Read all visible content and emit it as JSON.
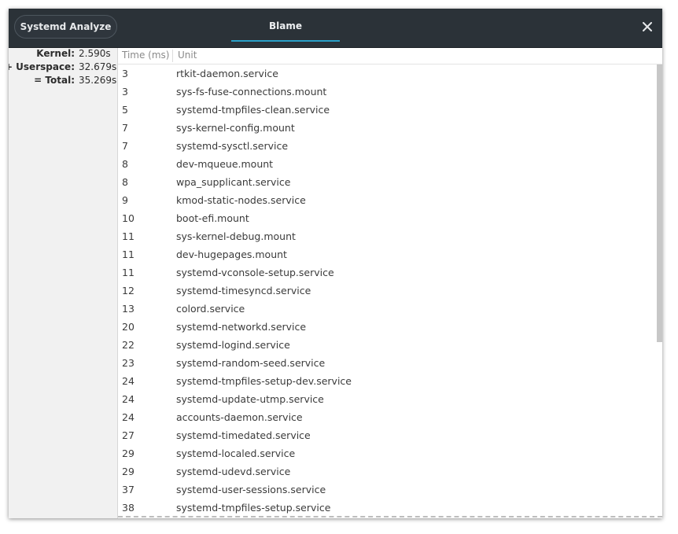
{
  "titlebar": {
    "app_button_label": "Systemd Analyze",
    "tab_label": "Blame",
    "close_icon": "close-icon",
    "accent_color": "#2aa0c8"
  },
  "summary": {
    "kernel_label": "Kernel:",
    "kernel_value": "2.590s",
    "userspace_label": "+ Userspace:",
    "userspace_value": "32.679s",
    "total_label": "= Total:",
    "total_value": "35.269s"
  },
  "table": {
    "columns": [
      "Time (ms)",
      "Unit"
    ],
    "rows": [
      [
        "3",
        "rtkit-daemon.service"
      ],
      [
        "3",
        "sys-fs-fuse-connections.mount"
      ],
      [
        "5",
        "systemd-tmpfiles-clean.service"
      ],
      [
        "7",
        "sys-kernel-config.mount"
      ],
      [
        "7",
        "systemd-sysctl.service"
      ],
      [
        "8",
        "dev-mqueue.mount"
      ],
      [
        "8",
        "wpa_supplicant.service"
      ],
      [
        "9",
        "kmod-static-nodes.service"
      ],
      [
        "10",
        "boot-efi.mount"
      ],
      [
        "11",
        "sys-kernel-debug.mount"
      ],
      [
        "11",
        "dev-hugepages.mount"
      ],
      [
        "11",
        "systemd-vconsole-setup.service"
      ],
      [
        "12",
        "systemd-timesyncd.service"
      ],
      [
        "13",
        "colord.service"
      ],
      [
        "20",
        "systemd-networkd.service"
      ],
      [
        "22",
        "systemd-logind.service"
      ],
      [
        "23",
        "systemd-random-seed.service"
      ],
      [
        "24",
        "systemd-tmpfiles-setup-dev.service"
      ],
      [
        "24",
        "systemd-update-utmp.service"
      ],
      [
        "24",
        "accounts-daemon.service"
      ],
      [
        "27",
        "systemd-timedated.service"
      ],
      [
        "29",
        "systemd-localed.service"
      ],
      [
        "29",
        "systemd-udevd.service"
      ],
      [
        "37",
        "systemd-user-sessions.service"
      ],
      [
        "38",
        "systemd-tmpfiles-setup.service"
      ]
    ]
  }
}
